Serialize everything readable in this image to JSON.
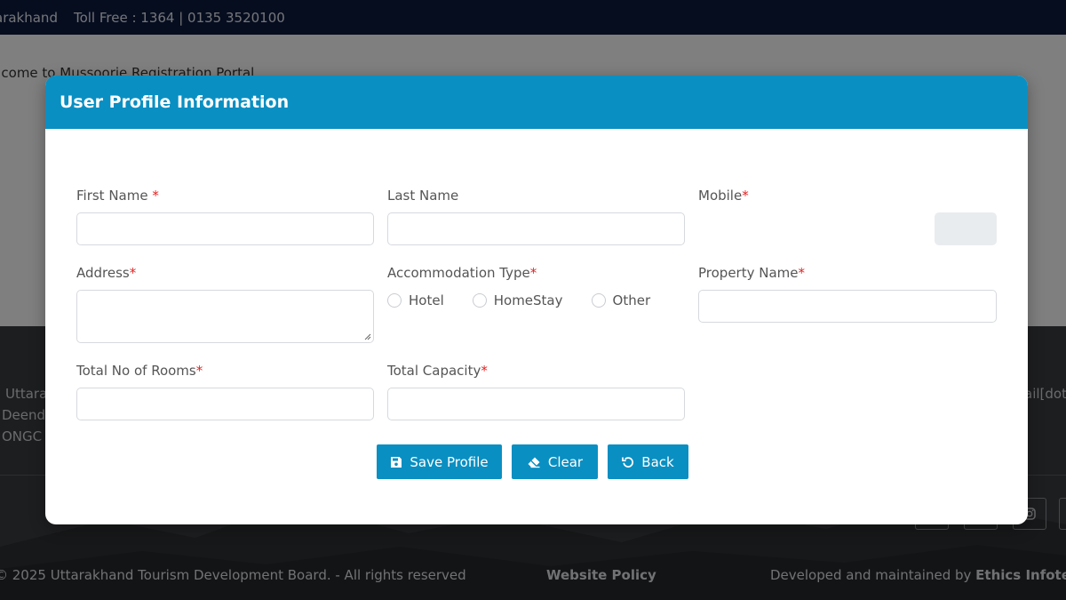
{
  "topbar": {
    "brand_fragment": "arakhand",
    "toll_free": "Toll Free : 1364 | 0135 3520100"
  },
  "page": {
    "welcome_text": "elcome to Mussoorie Registration Portal"
  },
  "footer": {
    "address_fragments": [
      "Uttara",
      "Deend",
      "ONGC"
    ],
    "email_fragment": "ail[dot",
    "copyright": "© 2025 Uttarakhand Tourism Development Board. - All rights reserved",
    "policy_link": "Website Policy",
    "developed_prefix": "Developed and maintained by ",
    "developer_name": "Ethics Infote"
  },
  "modal": {
    "title": "User Profile Information",
    "fields": {
      "first_name": {
        "label": "First Name ",
        "required": "*",
        "value": ""
      },
      "last_name": {
        "label": "Last Name",
        "value": ""
      },
      "mobile": {
        "label": "Mobile",
        "required": "*",
        "value": ""
      },
      "address": {
        "label": "Address",
        "required": "*",
        "value": ""
      },
      "accommodation_type": {
        "label": "Accommodation Type",
        "required": "*",
        "options": [
          "Hotel",
          "HomeStay",
          "Other"
        ],
        "selected": ""
      },
      "property_name": {
        "label": "Property Name",
        "required": "*",
        "value": ""
      },
      "total_rooms": {
        "label": "Total No of Rooms",
        "required": "*",
        "value": ""
      },
      "total_capacity": {
        "label": "Total Capacity",
        "required": "*",
        "value": ""
      }
    },
    "buttons": {
      "save": "Save Profile",
      "clear": "Clear",
      "back": "Back"
    }
  },
  "colors": {
    "accent": "#0a8fc2",
    "topbar": "#0d1b3e",
    "required": "#e02424"
  },
  "icons": {
    "save": "floppy-disk-icon",
    "clear": "eraser-icon",
    "back": "undo-icon"
  }
}
